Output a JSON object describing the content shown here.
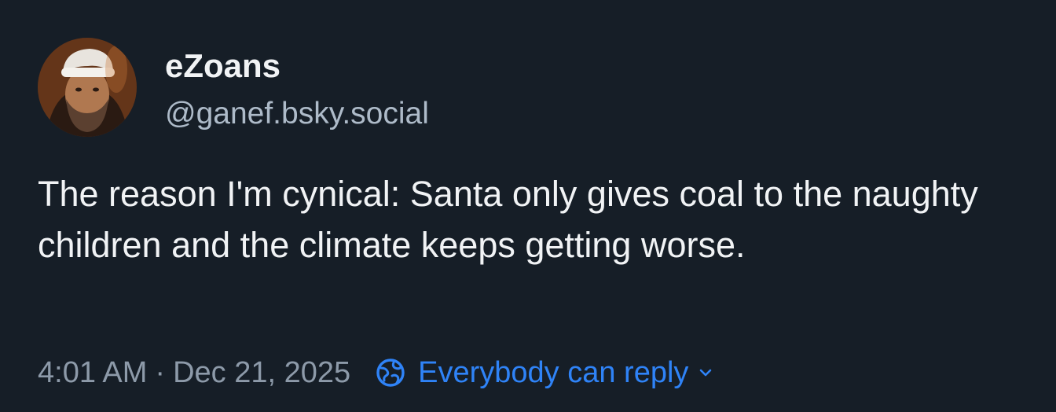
{
  "author": {
    "display_name": "eZoans",
    "handle": "@ganef.bsky.social",
    "avatar_icon": "user-avatar-photo"
  },
  "post": {
    "text": "The reason I'm cynical: Santa only gives coal to the naughty children and the climate keeps getting worse."
  },
  "meta": {
    "time": "4:01 AM",
    "separator": "·",
    "date": "Dec 21, 2025",
    "reply_setting": "Everybody can reply",
    "reply_icon": "globe-icon",
    "dropdown_icon": "chevron-down-icon"
  },
  "colors": {
    "background": "#161e27",
    "text": "#f1f3f5",
    "muted": "#8d9aa9",
    "handle": "#aebbc9",
    "accent": "#2f83f7"
  }
}
